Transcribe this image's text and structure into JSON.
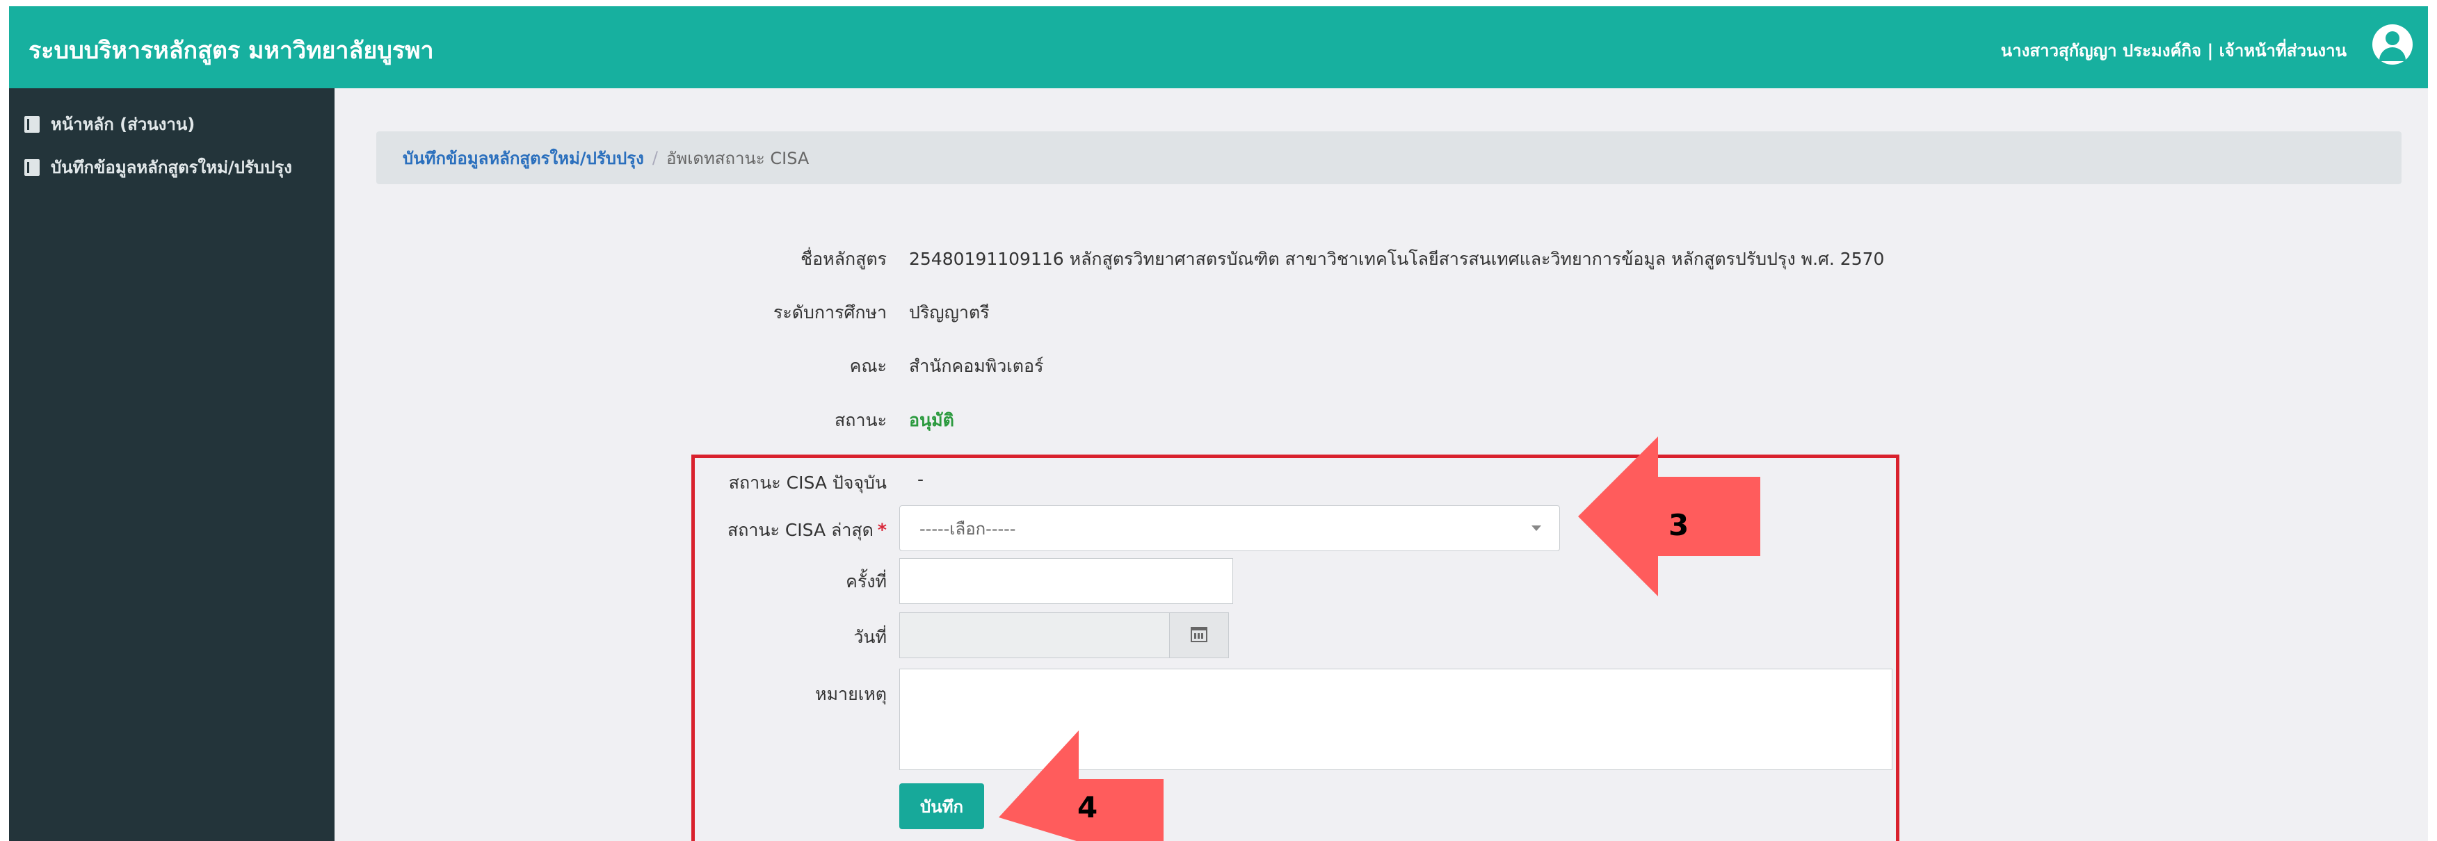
{
  "header": {
    "title": "ระบบบริหารหลักสูตร มหาวิทยาลัยบูรพา",
    "user": "นางสาวสุกัญญา ประมงค์กิจ | เจ้าหน้าที่ส่วนงาน"
  },
  "sidebar": {
    "items": [
      {
        "label": "หน้าหลัก (ส่วนงาน)",
        "icon": "book-icon"
      },
      {
        "label": "บันทึกข้อมูลหลักสูตรใหม่/ปรับปรุง",
        "icon": "book-icon"
      }
    ]
  },
  "breadcrumb": {
    "link": "บันทึกข้อมูลหลักสูตรใหม่/ปรับปรุง",
    "separator": "/",
    "current": "อัพเดทสถานะ CISA"
  },
  "details": {
    "curriculum_label": "ชื่อหลักสูตร",
    "curriculum_value": "25480191109116 หลักสูตรวิทยาศาสตรบัณฑิต สาขาวิชาเทคโนโลยีสารสนเทศและวิทยาการข้อมูล หลักสูตรปรับปรุง พ.ศ. 2570",
    "level_label": "ระดับการศึกษา",
    "level_value": "ปริญญาตรี",
    "faculty_label": "คณะ",
    "faculty_value": "สำนักคอมพิวเตอร์",
    "status_label": "สถานะ",
    "status_value": "อนุมัติ"
  },
  "form": {
    "current_cisa_label": "สถานะ CISA ปัจจุบัน",
    "current_cisa_value": "-",
    "latest_cisa_label": "สถานะ CISA ล่าสุด",
    "required_mark": "*",
    "latest_cisa_selected": "-----เลือก-----",
    "round_label": "ครั้งที่",
    "round_value": "",
    "date_label": "วันที่",
    "date_value": "",
    "note_label": "หมายเหตุ",
    "note_value": "",
    "save_label": "บันทึก"
  },
  "annotations": {
    "arrow_3": "3",
    "arrow_4": "4",
    "arrow_color": "#ff5c5c",
    "box_color": "#d9212d"
  },
  "colors": {
    "accent": "#17b09f",
    "sidebar": "#23343a",
    "approved": "#2b9a3e"
  }
}
